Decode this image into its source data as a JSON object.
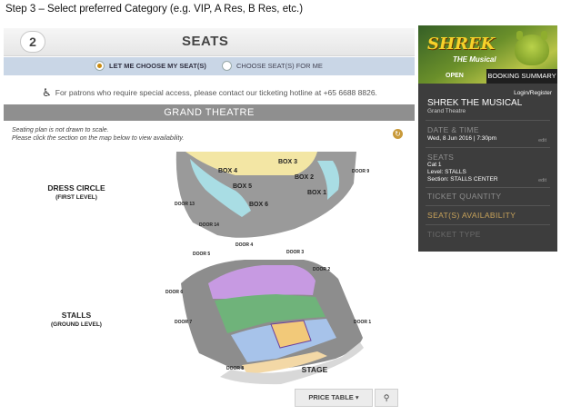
{
  "caption": "Step 3 – Select preferred Category (e.g. VIP, A Res, B Res, etc.)",
  "step": {
    "number": "2",
    "title": "SEATS"
  },
  "seat_options": {
    "choose": "LET ME CHOOSE MY SEAT(S)",
    "auto": "CHOOSE SEAT(S) FOR ME",
    "selected": "choose"
  },
  "access_note": "For patrons who require special access, please contact our ticketing hotline at +65 6688 8826.",
  "theatre_name": "GRAND THEATRE",
  "map_note_1": "Seating plan is not drawn to scale.",
  "map_note_2": "Please click the section on the map below to view availability.",
  "map": {
    "dress_circle": "DRESS CIRCLE",
    "dress_circle_sub": "(FIRST LEVEL)",
    "stalls": "STALLS",
    "stalls_sub": "(GROUND LEVEL)",
    "stage": "STAGE",
    "boxes": [
      "BOX 1",
      "BOX 2",
      "BOX 3",
      "BOX 4",
      "BOX 5",
      "BOX 6"
    ],
    "doors": [
      "DOOR 1",
      "DOOR 2",
      "DOOR 3",
      "DOOR 4",
      "DOOR 5",
      "DOOR 6",
      "DOOR 7",
      "DOOR 8",
      "DOOR 9",
      "DOOR 13",
      "DOOR 14"
    ]
  },
  "price_table": "PRICE TABLE",
  "summary": {
    "logo": "SHREK",
    "logo_sub": "THE Musical",
    "open_tag": "OPEN",
    "header": "BOOKING SUMMARY",
    "login": "Login/Register",
    "show": "SHREK THE MUSICAL",
    "venue": "Grand Theatre",
    "date_title": "DATE & TIME",
    "date_value": "Wed, 8 Jun 2016 | 7:30pm",
    "edit": "edit",
    "seats_title": "SEATS",
    "seats_lines": [
      "Cat 1",
      "Level: STALLS",
      "Section: STALLS CENTER"
    ],
    "qty_title": "TICKET QUANTITY",
    "avail_title": "SEAT(S) AVAILABILITY",
    "type_title": "TICKET TYPE"
  },
  "colors": {
    "selected_section": "#f2c979",
    "stage": "#f3d8a6",
    "box": "#a9dde4",
    "purple": "#c79ae2",
    "green": "#6fb37a",
    "blue": "#a7c3ea"
  }
}
